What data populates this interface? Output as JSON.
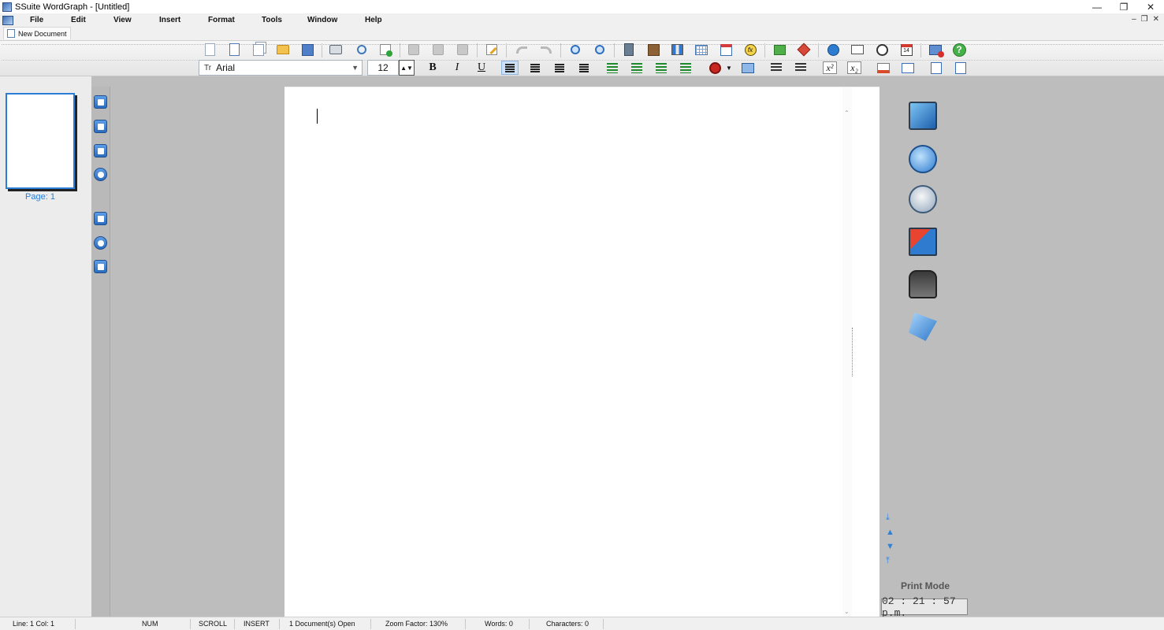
{
  "window": {
    "title": "SSuite WordGraph - [Untitled]"
  },
  "menu": {
    "items": [
      "File",
      "Edit",
      "View",
      "Insert",
      "Format",
      "Tools",
      "Window",
      "Help"
    ]
  },
  "tabs": [
    {
      "label": "New Document"
    }
  ],
  "toolbar": {
    "font_name": "Arial",
    "font_size": "12",
    "bold_label": "B",
    "italic_label": "I",
    "underline_label": "U",
    "superscript_label": "x²",
    "subscript_label": "x₂",
    "date_label": "14",
    "help_label": "?",
    "fx_label": "fx"
  },
  "pages_panel": {
    "page_label": "Page: 1"
  },
  "right_panel": {
    "mode_label": "Print Mode",
    "clock": "02 : 21 : 57 p.m."
  },
  "status": {
    "line_col": "Line:  1  Col:  1",
    "num": "NUM",
    "scroll": "SCROLL",
    "insert": "INSERT",
    "docs_open": "1 Document(s) Open",
    "zoom": "Zoom Factor: 130%",
    "words": "Words: 0",
    "characters": "Characters: 0"
  }
}
